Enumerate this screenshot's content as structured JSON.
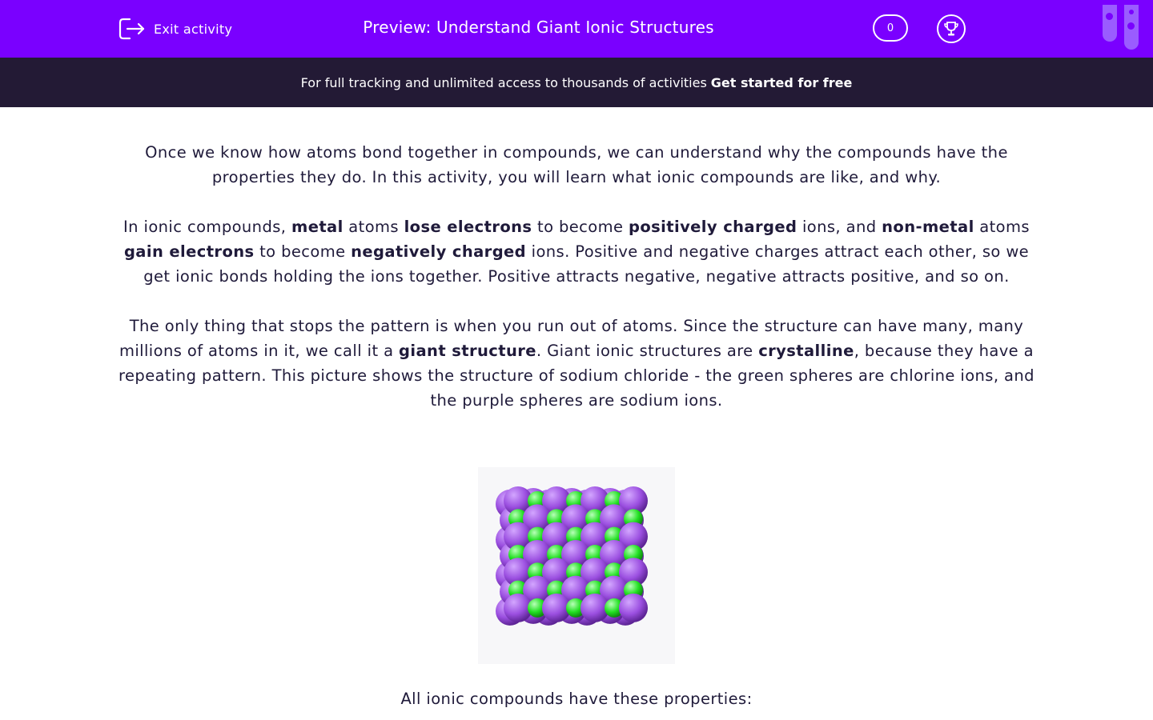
{
  "header": {
    "exit_label": "Exit activity",
    "title": "Preview: Understand Giant Ionic Structures",
    "score": "0",
    "brand_color": "#7a00ff"
  },
  "promo": {
    "text": "For full tracking and unlimited access to thousands of activities",
    "link": "Get started for free"
  },
  "paragraphs": {
    "p1": "Once we know how atoms bond together in compounds, we can understand why the compounds have the properties they do. In this activity, you will learn what ionic compounds are like, and why.",
    "p2": [
      "In ionic compounds, ",
      "metal",
      " atoms ",
      "lose electrons",
      " to become ",
      "positively charged",
      " ions, and ",
      "non-metal",
      " atoms ",
      "gain electrons",
      " to become ",
      "negatively charged",
      " ions. Positive and negative charges attract each other, so we get ionic bonds holding the ions together. Positive attracts negative, negative attracts positive, and so on."
    ],
    "p3": [
      "The only thing that stops the pattern is when you run out of atoms. Since the structure can have many, many millions of atoms in it, we call it a ",
      "giant structure",
      ". Giant ionic structures are ",
      "crystalline",
      ", because they have a repeating pattern. This picture shows the structure of sodium chloride - the green spheres are chlorine ions, and the purple spheres are sodium ions."
    ]
  },
  "image": {
    "sodium_color": "#9b4fe0",
    "chlorine_color": "#22e022"
  },
  "properties_heading": "All ionic compounds have these properties:"
}
